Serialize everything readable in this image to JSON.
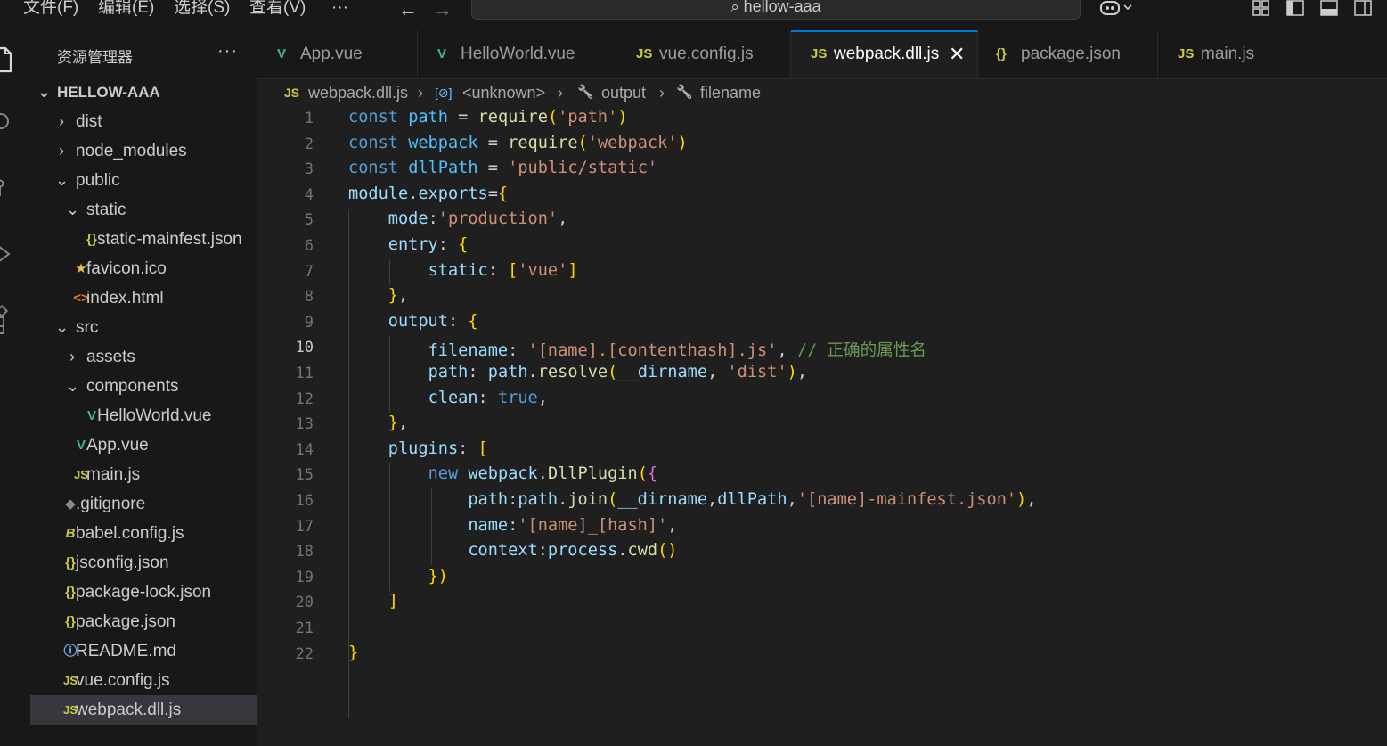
{
  "menu": {
    "file": "文件(F)",
    "edit": "编辑(E)",
    "selection": "选择(S)",
    "view": "查看(V)",
    "more": "···"
  },
  "search": {
    "placeholder": "hellow-aaa"
  },
  "icons": {
    "back": "arrow-left-icon",
    "forward": "arrow-right-icon",
    "search": "search-icon",
    "copilot": "copilot-icon",
    "layout": "layout-icons"
  },
  "sidebar": {
    "title": "资源管理器",
    "more": "···",
    "root": "HELLOW-AAA",
    "items": [
      {
        "label": "dist",
        "chevron": "›",
        "icon": ""
      },
      {
        "label": "node_modules",
        "chevron": "›",
        "icon": ""
      },
      {
        "label": "public",
        "chevron": "⌄",
        "icon": ""
      },
      {
        "label": "static",
        "chevron": "⌄",
        "icon": ""
      },
      {
        "label": "static-mainfest.json",
        "chevron": "",
        "icon": "{}"
      },
      {
        "label": "favicon.ico",
        "chevron": "",
        "icon": "★"
      },
      {
        "label": "index.html",
        "chevron": "",
        "icon": "<>"
      },
      {
        "label": "src",
        "chevron": "⌄",
        "icon": ""
      },
      {
        "label": "assets",
        "chevron": "›",
        "icon": ""
      },
      {
        "label": "components",
        "chevron": "⌄",
        "icon": ""
      },
      {
        "label": "HelloWorld.vue",
        "chevron": "",
        "icon": "V"
      },
      {
        "label": "App.vue",
        "chevron": "",
        "icon": "V"
      },
      {
        "label": "main.js",
        "chevron": "",
        "icon": "JS"
      },
      {
        "label": ".gitignore",
        "chevron": "",
        "icon": "◆"
      },
      {
        "label": "babel.config.js",
        "chevron": "",
        "icon": "B"
      },
      {
        "label": "jsconfig.json",
        "chevron": "",
        "icon": "{}"
      },
      {
        "label": "package-lock.json",
        "chevron": "",
        "icon": "{}"
      },
      {
        "label": "package.json",
        "chevron": "",
        "icon": "{}"
      },
      {
        "label": "README.md",
        "chevron": "",
        "icon": "ⓘ"
      },
      {
        "label": "vue.config.js",
        "chevron": "",
        "icon": "JS"
      },
      {
        "label": "webpack.dll.js",
        "chevron": "",
        "icon": "JS"
      }
    ]
  },
  "tabs": [
    {
      "label": "App.vue",
      "icon": "V"
    },
    {
      "label": "HelloWorld.vue",
      "icon": "V"
    },
    {
      "label": "vue.config.js",
      "icon": "JS"
    },
    {
      "label": "webpack.dll.js",
      "icon": "JS",
      "close": "✕"
    },
    {
      "label": "package.json",
      "icon": "{}"
    },
    {
      "label": "main.js",
      "icon": "JS"
    }
  ],
  "breadcrumb": {
    "file_icon": "JS",
    "file": "webpack.dll.js",
    "sep": "›",
    "unknown_icon": "[⊘]",
    "unknown": "<unknown>",
    "output_icon": "🔧",
    "output": "output",
    "filename_icon": "🔧",
    "filename": "filename"
  },
  "editor": {
    "line_numbers": [
      "1",
      "2",
      "3",
      "4",
      "5",
      "6",
      "7",
      "8",
      "9",
      "10",
      "11",
      "12",
      "13",
      "14",
      "15",
      "16",
      "17",
      "18",
      "19",
      "20",
      "21",
      "22"
    ],
    "lines": [
      "const path = require('path')",
      "const webpack = require('webpack')",
      "const dllPath = 'public/static'",
      "module.exports={",
      "    mode:'production',",
      "    entry: {",
      "        static: ['vue']",
      "    },",
      "    output: {",
      "        filename: '[name].[contenthash].js', // 正确的属性名",
      "        path: path.resolve(__dirname, 'dist'),",
      "        clean: true,",
      "    },",
      "    plugins: [",
      "        new webpack.DllPlugin({",
      "            path:path.join(__dirname,dllPath,'[name]-mainfest.json'),",
      "            name:'[name]_[hash]',",
      "            context:process.cwd()",
      "        })",
      "    ]",
      "",
      "}"
    ]
  },
  "colors": {
    "background": "#1f1f1f",
    "sidebar": "#181818",
    "accent": "#0078d4",
    "keyword": "#569cd6",
    "string": "#ce9178",
    "comment": "#6a9955",
    "vue": "#41b883",
    "js": "#cbcb41",
    "json": "#cbcb41"
  }
}
